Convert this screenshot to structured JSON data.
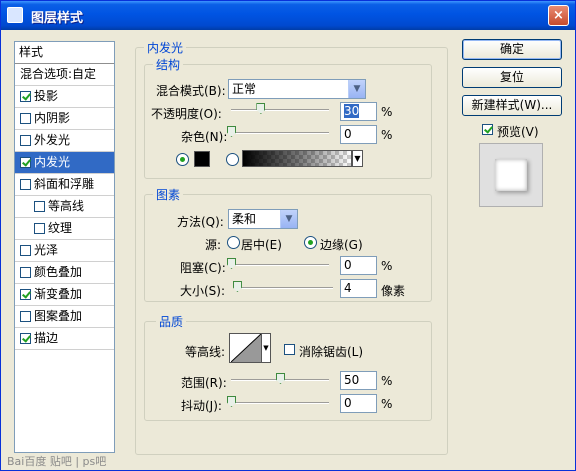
{
  "window": {
    "title": "图层样式",
    "close_glyph": "×"
  },
  "styles_list": {
    "header": "样式",
    "items": [
      {
        "label": "混合选项:自定",
        "checkbox": false,
        "checked": false
      },
      {
        "label": "投影",
        "checkbox": true,
        "checked": true
      },
      {
        "label": "内阴影",
        "checkbox": true,
        "checked": false
      },
      {
        "label": "外发光",
        "checkbox": true,
        "checked": false
      },
      {
        "label": "内发光",
        "checkbox": true,
        "checked": true,
        "selected": true
      },
      {
        "label": "斜面和浮雕",
        "checkbox": true,
        "checked": false
      },
      {
        "label": "等高线",
        "checkbox": true,
        "checked": false,
        "indent": true
      },
      {
        "label": "纹理",
        "checkbox": true,
        "checked": false,
        "indent": true
      },
      {
        "label": "光泽",
        "checkbox": true,
        "checked": false
      },
      {
        "label": "颜色叠加",
        "checkbox": true,
        "checked": false
      },
      {
        "label": "渐变叠加",
        "checkbox": true,
        "checked": true
      },
      {
        "label": "图案叠加",
        "checkbox": true,
        "checked": false
      },
      {
        "label": "描边",
        "checkbox": true,
        "checked": true
      }
    ]
  },
  "inner_glow": {
    "title": "内发光",
    "structure": {
      "title": "结构",
      "blend_mode_label": "混合模式(B):",
      "blend_mode_value": "正常",
      "opacity_label": "不透明度(O):",
      "opacity_value": "30",
      "opacity_unit": "%",
      "opacity_fraction": 0.3,
      "noise_label": "杂色(N):",
      "noise_value": "0",
      "noise_unit": "%",
      "noise_fraction": 0.0,
      "color_swatch": "#000000"
    },
    "elements": {
      "title": "图素",
      "technique_label": "方法(Q):",
      "technique_value": "柔和",
      "source_label": "源:",
      "source_center": "居中(E)",
      "source_edge": "边缘(G)",
      "source_selected": "edge",
      "choke_label": "阻塞(C):",
      "choke_value": "0",
      "choke_unit": "%",
      "choke_fraction": 0.0,
      "size_label": "大小(S):",
      "size_value": "4",
      "size_unit": "像素",
      "size_fraction": 0.02
    },
    "quality": {
      "title": "品质",
      "contour_label": "等高线:",
      "anti_alias_label": "消除锯齿(L)",
      "anti_alias_checked": false,
      "range_label": "范围(R):",
      "range_value": "50",
      "range_unit": "%",
      "range_fraction": 0.5,
      "jitter_label": "抖动(J):",
      "jitter_value": "0",
      "jitter_unit": "%",
      "jitter_fraction": 0.0
    }
  },
  "buttons": {
    "ok": "确定",
    "reset": "复位",
    "new_style": "新建样式(W)...",
    "preview_label": "预览(V)",
    "preview_checked": true
  },
  "watermark": "Bai百度 贴吧 | ps吧"
}
